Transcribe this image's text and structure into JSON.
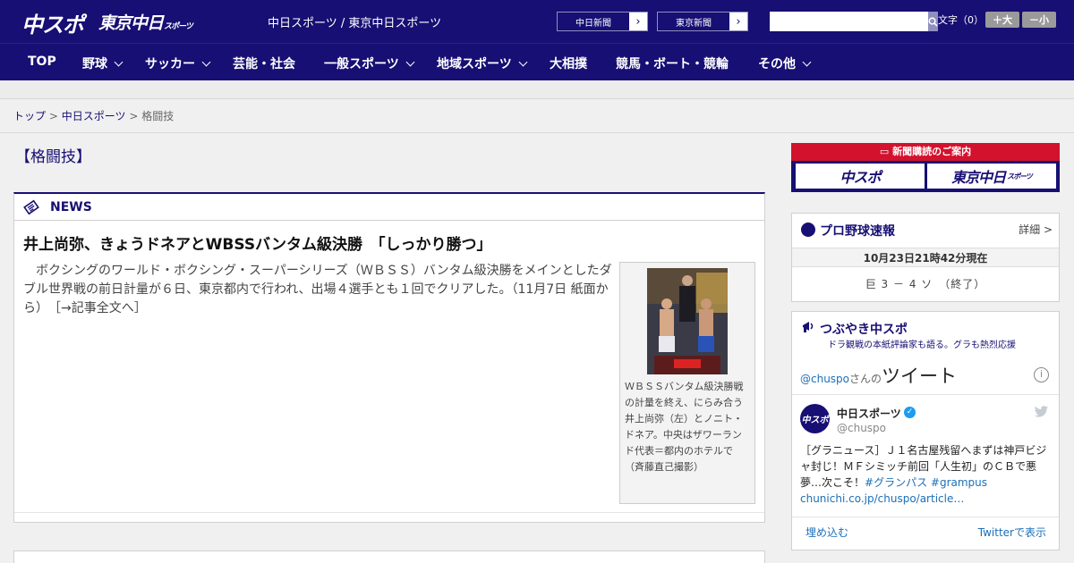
{
  "header": {
    "logo_primary": "中スポ",
    "logo_secondary": "東京中日",
    "logo_secondary_small": "スポーツ",
    "site_title": "中日スポーツ / 東京中日スポーツ",
    "ext_links": [
      {
        "label": "中日新聞"
      },
      {
        "label": "東京新聞"
      }
    ],
    "search_placeholder": "",
    "font_size_label": "文字（0）",
    "font_larger": "＋大",
    "font_smaller": "－小"
  },
  "nav": {
    "items": [
      {
        "label": "TOP",
        "dropdown": false
      },
      {
        "label": "野球",
        "dropdown": true
      },
      {
        "label": "サッカー",
        "dropdown": true
      },
      {
        "label": "芸能・社会",
        "dropdown": false
      },
      {
        "label": "一般スポーツ",
        "dropdown": true
      },
      {
        "label": "地域スポーツ",
        "dropdown": true
      },
      {
        "label": "大相撲",
        "dropdown": false
      },
      {
        "label": "競馬・ボート・競輪",
        "dropdown": false
      },
      {
        "label": "その他",
        "dropdown": true
      }
    ]
  },
  "breadcrumb": {
    "home": "トップ",
    "sep1": ">",
    "section": "中日スポーツ",
    "sep2": ">",
    "current": "格闘技"
  },
  "page": {
    "heading": "【格闘技】"
  },
  "news": {
    "label": "NEWS",
    "title": "井上尚弥、きょうドネアとWBSSバンタム級決勝　「しっかり勝つ」",
    "body": "　ボクシングのワールド・ボクシング・スーパーシリーズ（ＷＢＳＳ）バンタム級決勝をメインとしたダブル世界戦の前日計量が６日、東京都内で行われ、出場４選手とも１回でクリアした。（11月7日 紙面から）",
    "more_link": "［→記事全文へ］",
    "caption": "ＷＢＳＳバンタム級決勝戦の計量を終え、にらみ合う井上尚弥（左）とノニト・ドネア。中央はザワーランド代表＝都内のホテルで（斉藤直己撮影）"
  },
  "sidebar": {
    "subscribe": {
      "header": "新聞購読のご案内",
      "btn1": "中スポ",
      "btn2_main": "東京中日",
      "btn2_small": "スポーツ"
    },
    "baseball": {
      "title": "プロ野球速報",
      "detail": "詳細 >",
      "time": "10月23日21時42分現在",
      "score": "巨 3 － 4 ソ　（終了）"
    },
    "tweets": {
      "title": "つぶやき中スポ",
      "subtitle": "ドラ観戦の本紙評論家も語る。グラも熱烈応援",
      "handle": "@chuspo",
      "handle_suffix": "さんの",
      "heading": "ツイート",
      "info": "i",
      "avatar_text": "中スポ",
      "name": "中日スポーツ",
      "verified": "✓",
      "at": "@chuspo",
      "text_pre": "［グラニュース］Ｊ１名古屋残留へまずは神戸ビジャ封じ！ＭＦシミッチ前回「人生初」のＣＢで悪夢…次こそ！",
      "tag1": "#グランパス",
      "tag2": "#grampus",
      "link": "chunichi.co.jp/chuspo/article…",
      "embed": "埋め込む",
      "view": "Twitterで表示"
    }
  },
  "colors": {
    "brand_navy": "#170f73",
    "accent_red": "#d3122d",
    "link_blue": "#1b6fb8"
  }
}
